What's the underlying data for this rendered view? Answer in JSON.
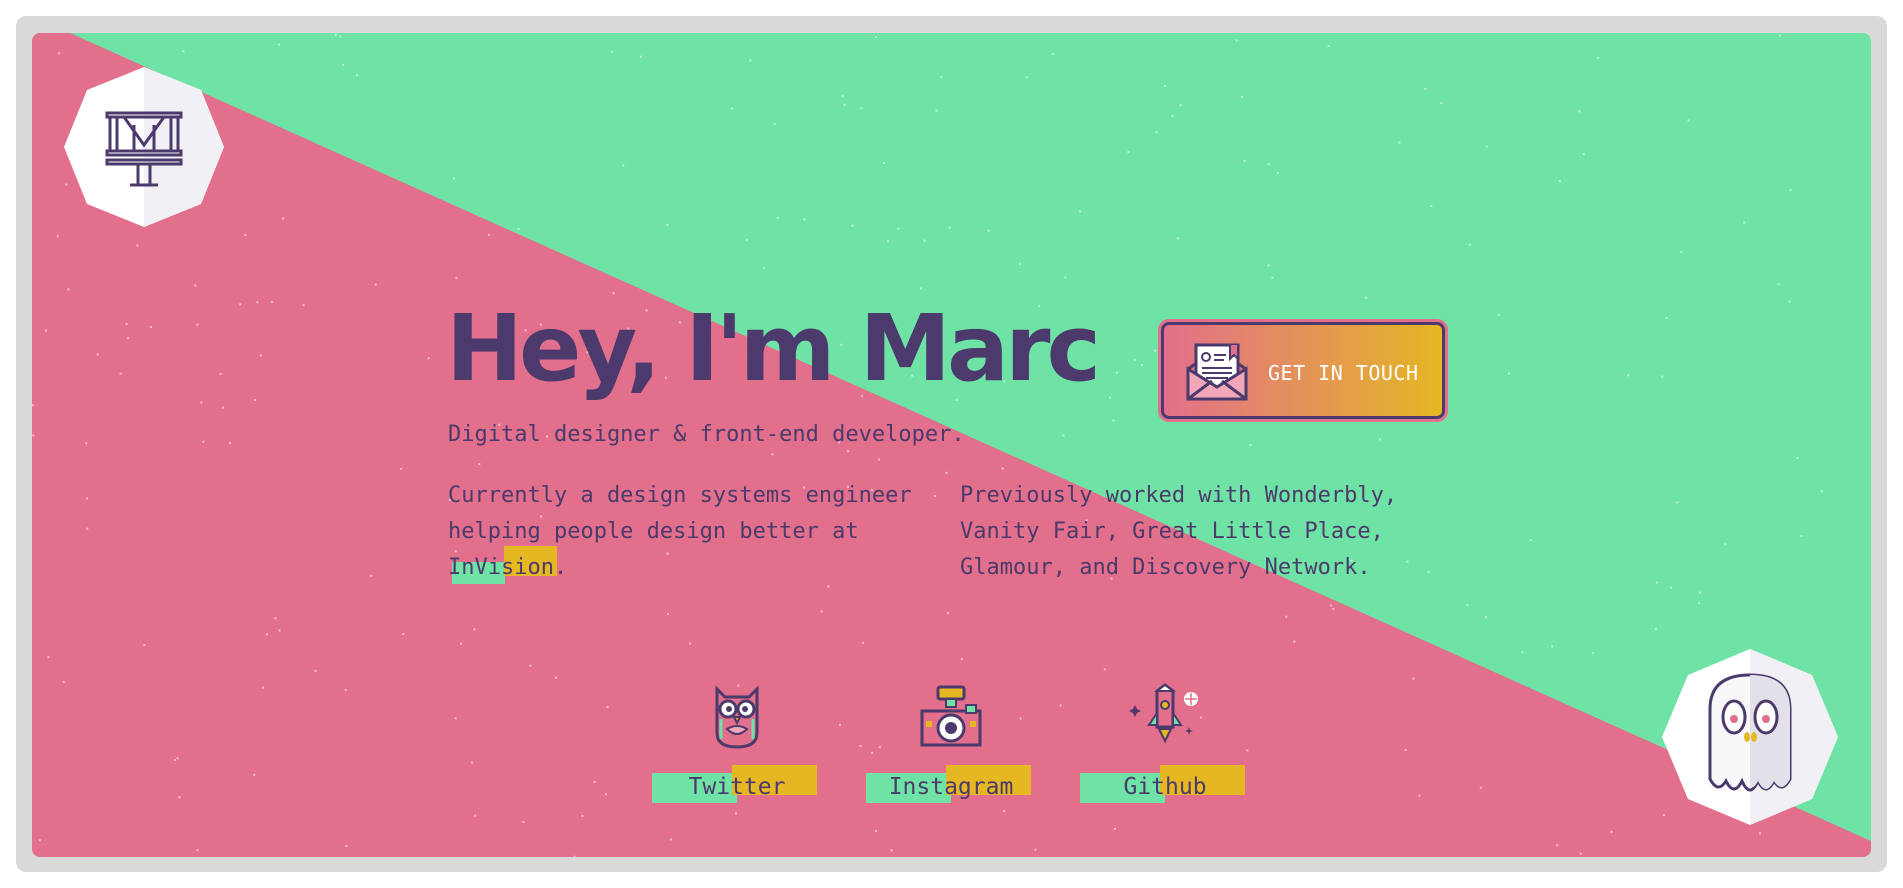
{
  "colors": {
    "pink": "#e26f8c",
    "green": "#6fe3a6",
    "yellow": "#e5b723",
    "purple": "#4b3a6b",
    "frame": "#d9d9d9"
  },
  "logo": {
    "icon": "mt-monogram-icon",
    "letters": "MT"
  },
  "hero": {
    "title": "Hey, I'm Marc",
    "subtitle": "Digital designer & front-end developer."
  },
  "intro": {
    "current_prefix": "Currently a design systems engineer helping people design better at ",
    "current_company": "InVision",
    "current_suffix": ".",
    "previous": "Previously worked with Wonderbly, Vanity Fair, Great Little Place, Glamour, and Discovery Network."
  },
  "cta": {
    "label": "GET IN TOUCH",
    "icon": "envelope-letter-icon"
  },
  "social": [
    {
      "label": "Twitter",
      "icon": "owl-icon"
    },
    {
      "label": "Instagram",
      "icon": "camera-icon"
    },
    {
      "label": "Github",
      "icon": "rocket-icon"
    }
  ],
  "mascot": {
    "icon": "ghost-skull-icon"
  }
}
